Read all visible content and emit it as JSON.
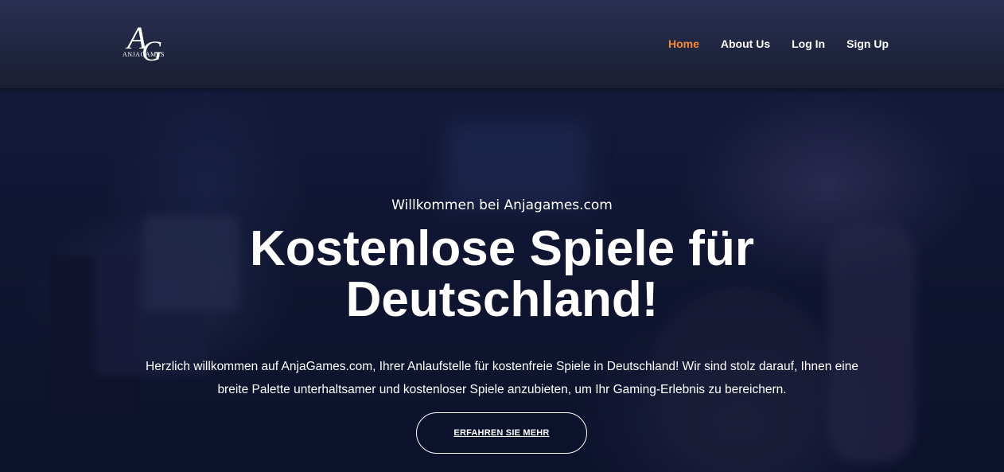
{
  "brand": {
    "logo_letter_a": "A",
    "logo_letter_g": "G",
    "logo_wordmark": "ANJAGAMES"
  },
  "nav": {
    "items": [
      {
        "label": "Home",
        "active": true
      },
      {
        "label": "About Us",
        "active": false
      },
      {
        "label": "Log In",
        "active": false
      },
      {
        "label": "Sign Up",
        "active": false
      }
    ]
  },
  "hero": {
    "subtitle": "Willkommen bei Anjagames.com",
    "title_line1": "Kostenlose Spiele für",
    "title_line2": "Deutschland!",
    "description_line1": "Herzlich willkommen auf AnjaGames.com, Ihrer Anlaufstelle für kostenfreie Spiele in Deutschland! Wir sind stolz darauf, Ihnen eine",
    "description_line2": "breite Palette unterhaltsamer und kostenloser Spiele anzubieten, um Ihr Gaming-Erlebnis zu bereichern.",
    "cta_label": "ERFAHREN SIE MEHR"
  },
  "colors": {
    "accent": "#f08a3c",
    "header_bg": "#23283f",
    "text": "#ffffff"
  }
}
